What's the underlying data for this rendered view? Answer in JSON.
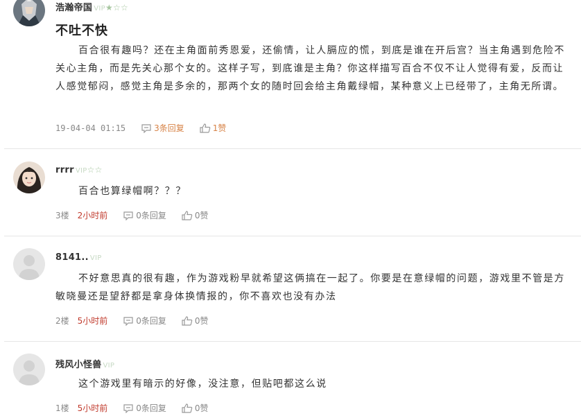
{
  "comments": [
    {
      "username": "浩瀚帝国",
      "vip": "VIP",
      "stars": "★☆☆",
      "title": "不吐不快",
      "text": "百合很有趣吗？还在主角面前秀恩爱，还偷情，让人膈应的慌，到底是谁在开后宫？当主角遇到危险不关心主角，而是先关心那个女的。这样子写，到底谁是主角？你这样描写百合不仅不让人觉得有爱，反而让人感觉郁闷，感觉主角是多余的，那两个女的随时回会给主角戴绿帽，某种意义上已经带了，主角无所谓。",
      "time": "19-04-04 01:15",
      "replies": "3条回复",
      "likes": "1赞"
    },
    {
      "username": "rrrr",
      "vip": "VIP",
      "stars": "☆☆",
      "text": "百合也算绿帽啊？？？",
      "floor": "3楼",
      "time": "2小时前",
      "replies": "0条回复",
      "likes": "0赞"
    },
    {
      "username": "8141..",
      "vip": "VIP",
      "text": "不好意思真的很有趣，作为游戏粉早就希望这俩搞在一起了。你要是在意绿帽的问题，游戏里不管是方敏晓曼还是望舒都是拿身体换情报的，你不喜欢也没有办法",
      "floor": "2楼",
      "time": "5小时前",
      "replies": "0条回复",
      "likes": "0赞"
    },
    {
      "username": "残风小怪兽",
      "vip": "VIP",
      "text": "这个游戏里有暗示的好像，没注意，但贴吧都这么说",
      "floor": "1楼",
      "time": "5小时前",
      "replies": "0条回复",
      "likes": "0赞"
    }
  ],
  "colors": {
    "accent_orange": "#d78347",
    "time_red": "#c0392b",
    "vip_green": "#a7c7a0"
  },
  "icons": {
    "reply": "comment-bubble-icon",
    "like": "thumbs-up-icon"
  }
}
